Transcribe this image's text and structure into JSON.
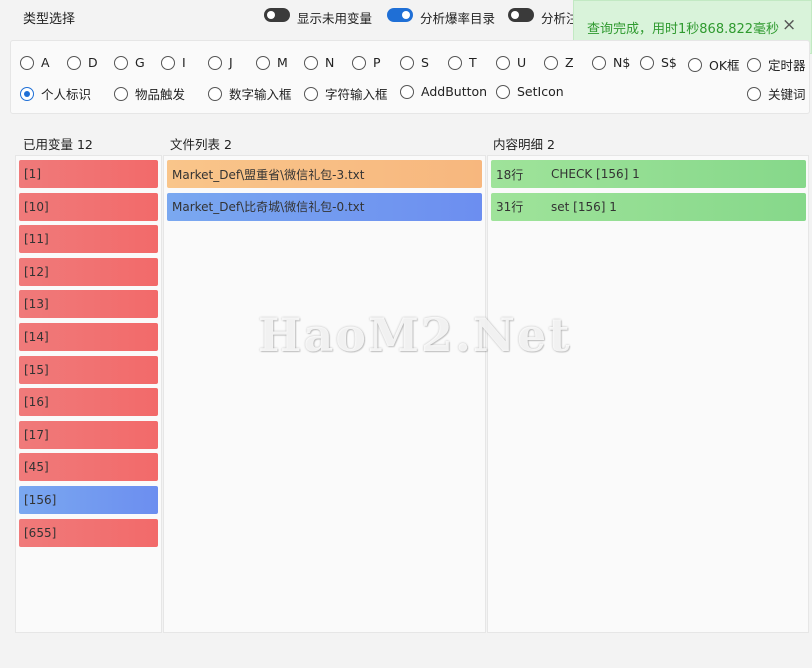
{
  "header": {
    "title": "类型选择",
    "toggles": [
      {
        "label": "显示未用变量",
        "on": false
      },
      {
        "label": "分析爆率目录",
        "on": true
      },
      {
        "label": "分析注",
        "on": false
      }
    ]
  },
  "toast": {
    "message": "查询完成，用时1秒868.822毫秒",
    "close": "×",
    "color": "#2f9a2f"
  },
  "options": {
    "row1": [
      "A",
      "D",
      "G",
      "I",
      "J",
      "M",
      "N",
      "P",
      "S",
      "T",
      "U",
      "Z",
      "N$",
      "S$",
      "OK框",
      "定时器"
    ],
    "row2": [
      "个人标识",
      "物品触发",
      "数字输入框",
      "字符输入框",
      "AddButton",
      "SetIcon"
    ],
    "row2_right": "关键词",
    "selected": "个人标识"
  },
  "variables": {
    "title": "已用变量 12",
    "items": [
      {
        "label": "[1]",
        "color": "red"
      },
      {
        "label": "[10]",
        "color": "red"
      },
      {
        "label": "[11]",
        "color": "red"
      },
      {
        "label": "[12]",
        "color": "red"
      },
      {
        "label": "[13]",
        "color": "red"
      },
      {
        "label": "[14]",
        "color": "red"
      },
      {
        "label": "[15]",
        "color": "red"
      },
      {
        "label": "[16]",
        "color": "red"
      },
      {
        "label": "[17]",
        "color": "red"
      },
      {
        "label": "[45]",
        "color": "red"
      },
      {
        "label": "[156]",
        "color": "blue"
      },
      {
        "label": "[655]",
        "color": "red"
      }
    ]
  },
  "files": {
    "title": "文件列表 2",
    "items": [
      {
        "label": "Market_Def\\盟重省\\微信礼包-3.txt",
        "color": "orange"
      },
      {
        "label": "Market_Def\\比奇城\\微信礼包-0.txt",
        "color": "blue"
      }
    ]
  },
  "details": {
    "title": "内容明细 2",
    "items": [
      {
        "line": "18行",
        "content": "CHECK [156] 1"
      },
      {
        "line": "31行",
        "content": "set [156] 1"
      }
    ]
  },
  "watermark": "HaoM2.Net"
}
